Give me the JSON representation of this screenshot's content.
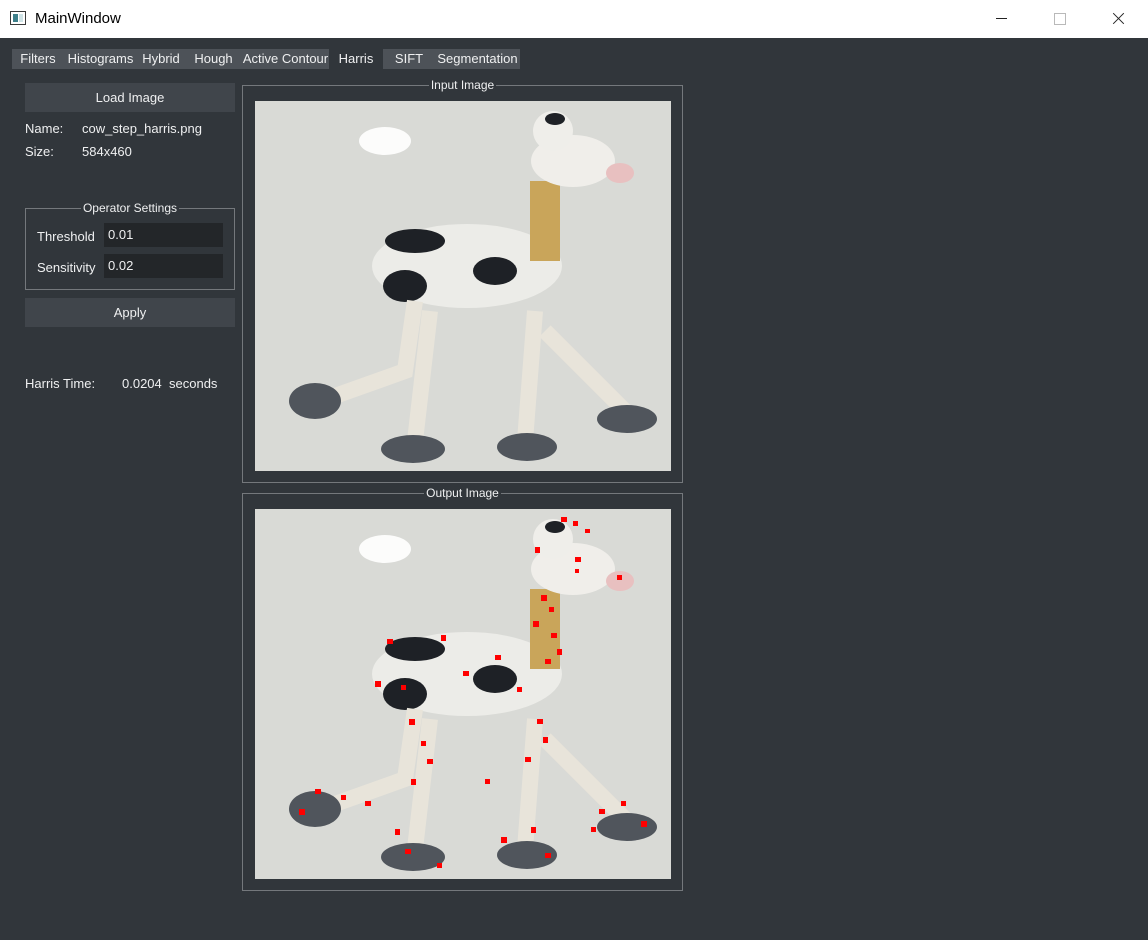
{
  "window": {
    "title": "MainWindow",
    "icon": "app-window-icon",
    "controls": [
      "minimize",
      "maximize",
      "close"
    ]
  },
  "tabs": [
    {
      "label": "Filters"
    },
    {
      "label": "Histograms"
    },
    {
      "label": "Hybrid"
    },
    {
      "label": "Hough"
    },
    {
      "label": "Active Contour"
    },
    {
      "label": "Harris",
      "active": true
    },
    {
      "label": "SIFT"
    },
    {
      "label": "Segmentation"
    }
  ],
  "sidebar": {
    "load_button": "Load Image",
    "name_label": "Name:",
    "name_value": "cow_step_harris.png",
    "size_label": "Size:",
    "size_value": "584x460",
    "operator_group_title": "Operator Settings",
    "threshold_label": "Threshold",
    "threshold_value": "0.01",
    "sensitivity_label": "Sensitivity",
    "sensitivity_value": "0.02",
    "apply_button": "Apply",
    "time_label": "Harris Time:",
    "time_value": "0.0204",
    "time_unit": "seconds"
  },
  "panels": {
    "input_title": "Input Image",
    "output_title": "Output Image"
  },
  "colors": {
    "background": "#31363b",
    "button": "#40454b",
    "input_bg": "#232629",
    "corner_marker": "#ff0000"
  }
}
